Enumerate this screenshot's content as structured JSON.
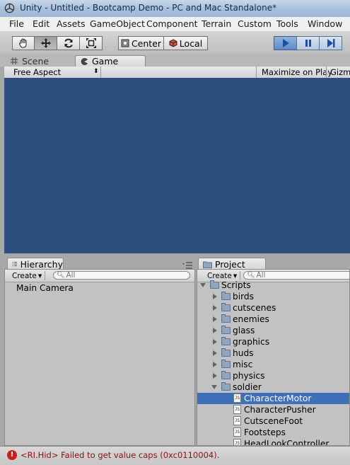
{
  "window": {
    "title": "Unity - Untitled - Bootcamp Demo - PC and Mac Standalone*"
  },
  "menu": [
    "File",
    "Edit",
    "Assets",
    "GameObject",
    "Component",
    "Terrain",
    "Custom",
    "Tools",
    "Window"
  ],
  "toolbar": {
    "pivot_label": "Center",
    "space_label": "Local"
  },
  "view_tabs": {
    "scene": "Scene",
    "game": "Game"
  },
  "game_toolbar": {
    "aspect": "Free Aspect",
    "maximize": "Maximize on Play",
    "gizmos": "Gizmo"
  },
  "hierarchy": {
    "tab_label": "Hierarchy",
    "create_label": "Create",
    "search_placeholder": "All",
    "items": [
      "Main Camera"
    ]
  },
  "project": {
    "tab_label": "Project",
    "create_label": "Create",
    "search_placeholder": "All",
    "root": "Scripts",
    "folders": [
      "birds",
      "cutscenes",
      "enemies",
      "glass",
      "graphics",
      "huds",
      "misc",
      "physics"
    ],
    "open_folder": "soldier",
    "files": [
      "CharacterMotor",
      "CharacterPusher",
      "CutsceneFoot",
      "Footsteps",
      "HeadLookController"
    ],
    "selected_file": "CharacterMotor"
  },
  "status": {
    "message": "<RI.Hid> Failed to get value caps (0xc0110004)."
  },
  "colors": {
    "game_view": "#2e4e7d",
    "selection": "#3f6fb8",
    "error": "#c81e1e"
  }
}
